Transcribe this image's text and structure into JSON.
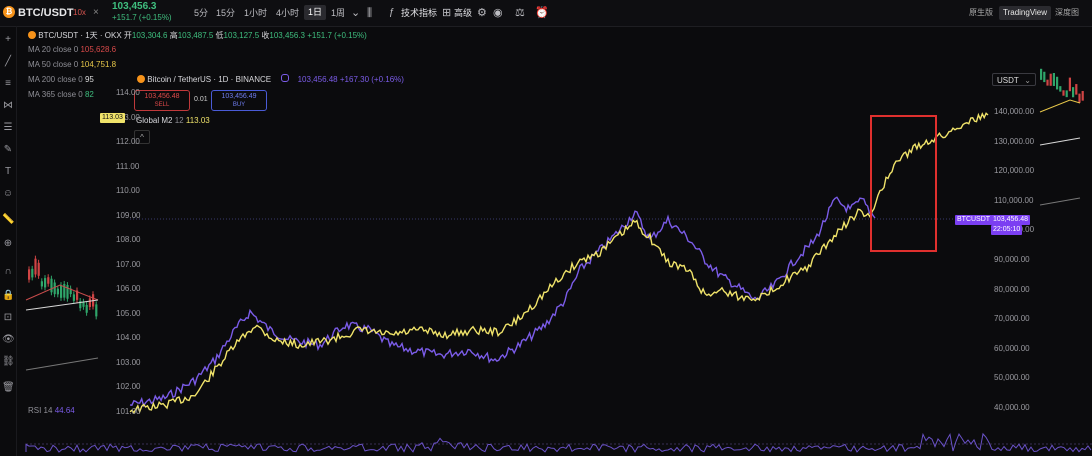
{
  "topbar": {
    "symbol": "BTC/USDT",
    "leverage": "10x",
    "close_glyph": "×",
    "price": "103,456.3",
    "change": "+151.7 (+0.15%)",
    "intervals": [
      {
        "label": "5分"
      },
      {
        "label": "15分"
      },
      {
        "label": "1小时"
      },
      {
        "label": "4小时"
      },
      {
        "label": "1日",
        "active": true
      },
      {
        "label": "1周"
      }
    ],
    "dropdown_glyph": "⌄",
    "indicators_label": "技术指标",
    "advanced_label": "高级",
    "view_buttons": [
      "原生版",
      "TradingView",
      "深度图"
    ]
  },
  "outer_chart": {
    "title": "BTC/USDT · 1天 · OKX",
    "ohlc": {
      "open_label": "开",
      "open": "103,304.6",
      "high_label": "高",
      "high": "103,487.5",
      "low_label": "低",
      "low": "103,127.5",
      "close_label": "收",
      "close": "103,456.3",
      "change": "+151.7 (+0.15%)"
    },
    "ma": [
      {
        "label": "MA 20 close 0",
        "value": "105,628.6",
        "color": "#d94a4a"
      },
      {
        "label": "MA 50 close 0",
        "value": "104,751.8",
        "color": "#e8c84a"
      },
      {
        "label": "MA 200 close 0",
        "value": "95",
        "color": "#c9c9c9"
      },
      {
        "label": "MA 365 close 0",
        "value": "82",
        "color": "#3fbf7f"
      }
    ],
    "rsi": {
      "label": "RSI 14",
      "value": "44.64"
    }
  },
  "inner_chart": {
    "title": "Bitcoin / TetherUS · 1D · BINANCE",
    "price": "103,456.48",
    "change": "+167.30 (+0.16%)",
    "sell": {
      "value": "103,456.48",
      "label": "SELL"
    },
    "spread": "0.01",
    "buy": {
      "value": "103,456.49",
      "label": "BUY"
    },
    "m2_legend": {
      "label": "Global M2",
      "param": "12",
      "value": "113.03"
    },
    "collapse_glyph": "^",
    "currency_select": "USDT",
    "btc_tag": {
      "symbol": "BTCUSDT",
      "price": "103,456.48",
      "countdown": "22:05:10"
    },
    "m2_tag": "113.03",
    "left_axis_ticks": [
      "114.00",
      "113.00",
      "112.00",
      "111.00",
      "110.00",
      "109.00",
      "108.00",
      "107.00",
      "106.00",
      "105.00",
      "104.00",
      "103.00",
      "102.00",
      "101.00"
    ],
    "right_axis_ticks": [
      "140,000.00",
      "130,000.00",
      "120,000.00",
      "110,000.00",
      "100,000.00",
      "90,000.00",
      "80,000.00",
      "70,000.00",
      "60,000.00",
      "50,000.00",
      "40,000.00"
    ],
    "colors": {
      "btc": "#7b5ce8",
      "m2": "#f0e36a",
      "highlight": "#e0302e"
    }
  }
}
